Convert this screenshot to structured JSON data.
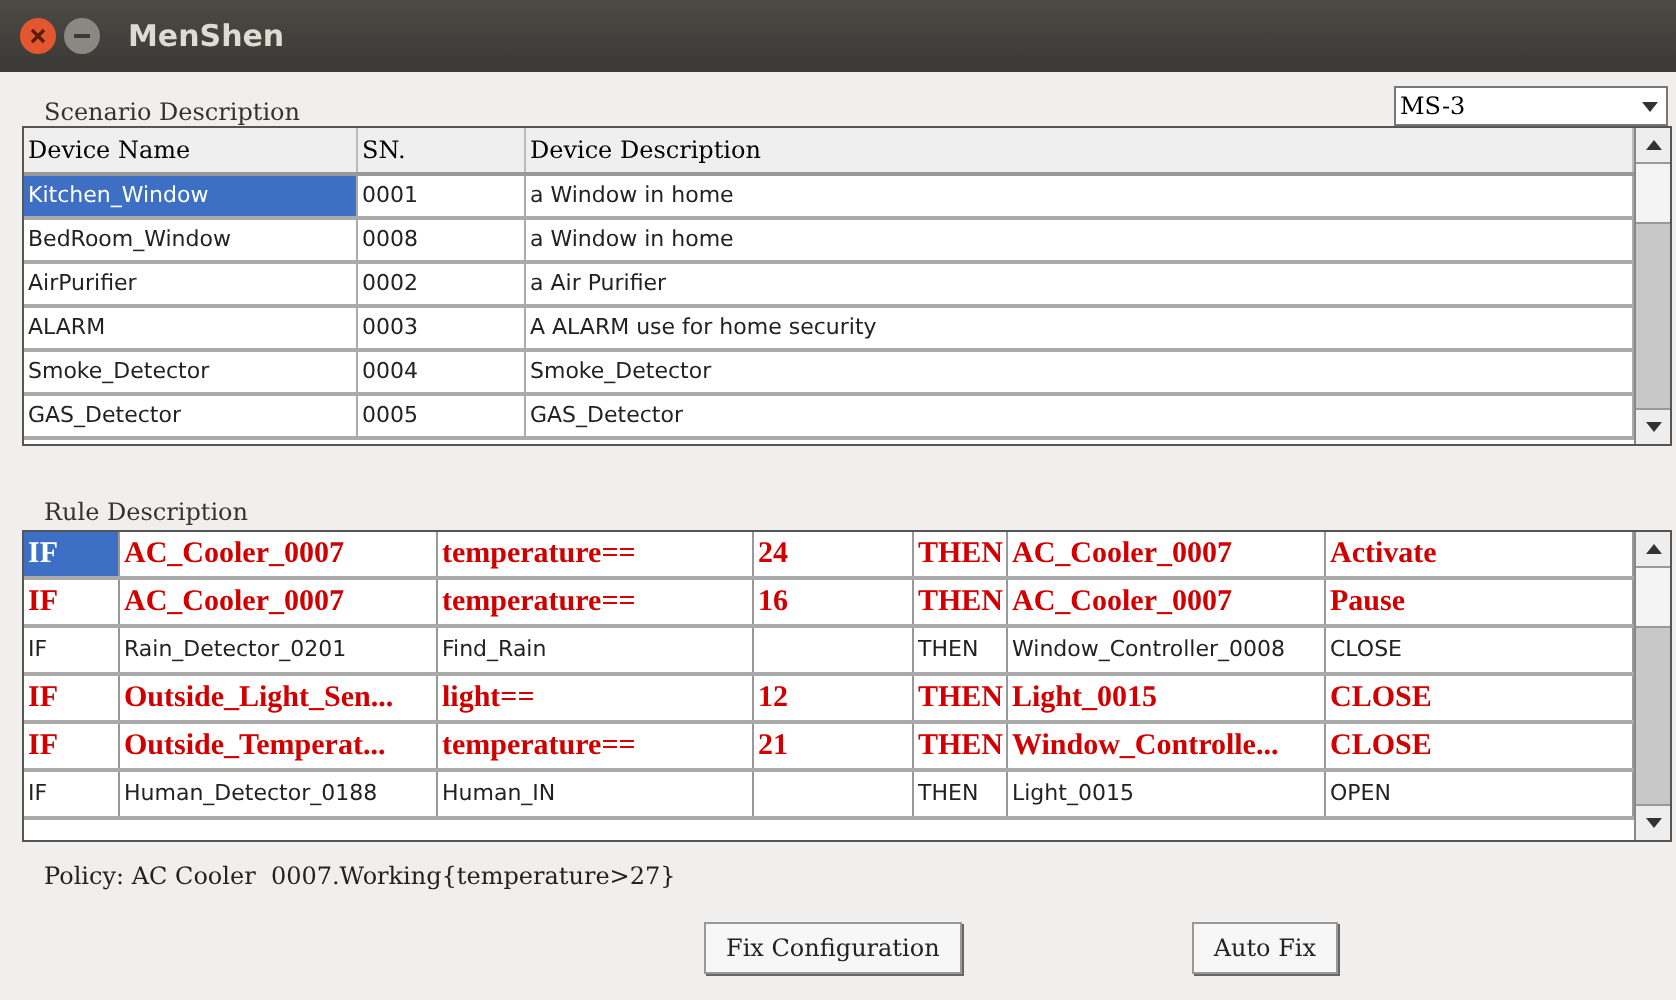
{
  "window": {
    "title": "MenShen"
  },
  "scenario": {
    "label": "Scenario Description",
    "dropdown": {
      "value": "MS-3"
    },
    "columns": [
      "Device Name",
      "SN.",
      "Device Description"
    ],
    "rows": [
      {
        "selected": true,
        "cells": [
          "Kitchen_Window",
          "0001",
          "a Window in home"
        ]
      },
      {
        "selected": false,
        "cells": [
          "BedRoom_Window",
          "0008",
          "a Window in home"
        ]
      },
      {
        "selected": false,
        "cells": [
          "AirPurifier",
          "0002",
          "a Air Purifier"
        ]
      },
      {
        "selected": false,
        "cells": [
          "ALARM",
          "0003",
          "A ALARM use for home security"
        ]
      },
      {
        "selected": false,
        "cells": [
          "Smoke_Detector",
          "0004",
          "Smoke_Detector"
        ]
      },
      {
        "selected": false,
        "cells": [
          "GAS_Detector",
          "0005",
          "GAS_Detector"
        ]
      }
    ]
  },
  "rules": {
    "label": "Rule Description",
    "rows": [
      {
        "selected": true,
        "kind": "conflict",
        "cells": [
          "IF",
          "AC_Cooler_0007",
          "temperature==",
          "24",
          "THEN",
          "AC_Cooler_0007",
          "Activate"
        ]
      },
      {
        "selected": false,
        "kind": "conflict",
        "cells": [
          "IF",
          "AC_Cooler_0007",
          "temperature==",
          "16",
          "THEN",
          "AC_Cooler_0007",
          "Pause"
        ]
      },
      {
        "selected": false,
        "kind": "normal",
        "cells": [
          "IF",
          "Rain_Detector_0201",
          "Find_Rain",
          "",
          "THEN",
          "Window_Controller_0008",
          "CLOSE"
        ]
      },
      {
        "selected": false,
        "kind": "conflict",
        "cells": [
          "IF",
          "Outside_Light_Sen...",
          "light==",
          "12",
          "THEN",
          "Light_0015",
          "CLOSE"
        ]
      },
      {
        "selected": false,
        "kind": "conflict",
        "cells": [
          "IF",
          "Outside_Temperat...",
          "temperature==",
          "21",
          "THEN",
          "Window_Controlle...",
          "CLOSE"
        ]
      },
      {
        "selected": false,
        "kind": "normal",
        "cells": [
          "IF",
          "Human_Detector_0188",
          "Human_IN",
          "",
          "THEN",
          "Light_0015",
          "OPEN"
        ]
      }
    ]
  },
  "policy": "Policy: AC Cooler  0007.Working{temperature>27}",
  "buttons": [
    "Fix Configuration",
    "Auto Fix"
  ]
}
